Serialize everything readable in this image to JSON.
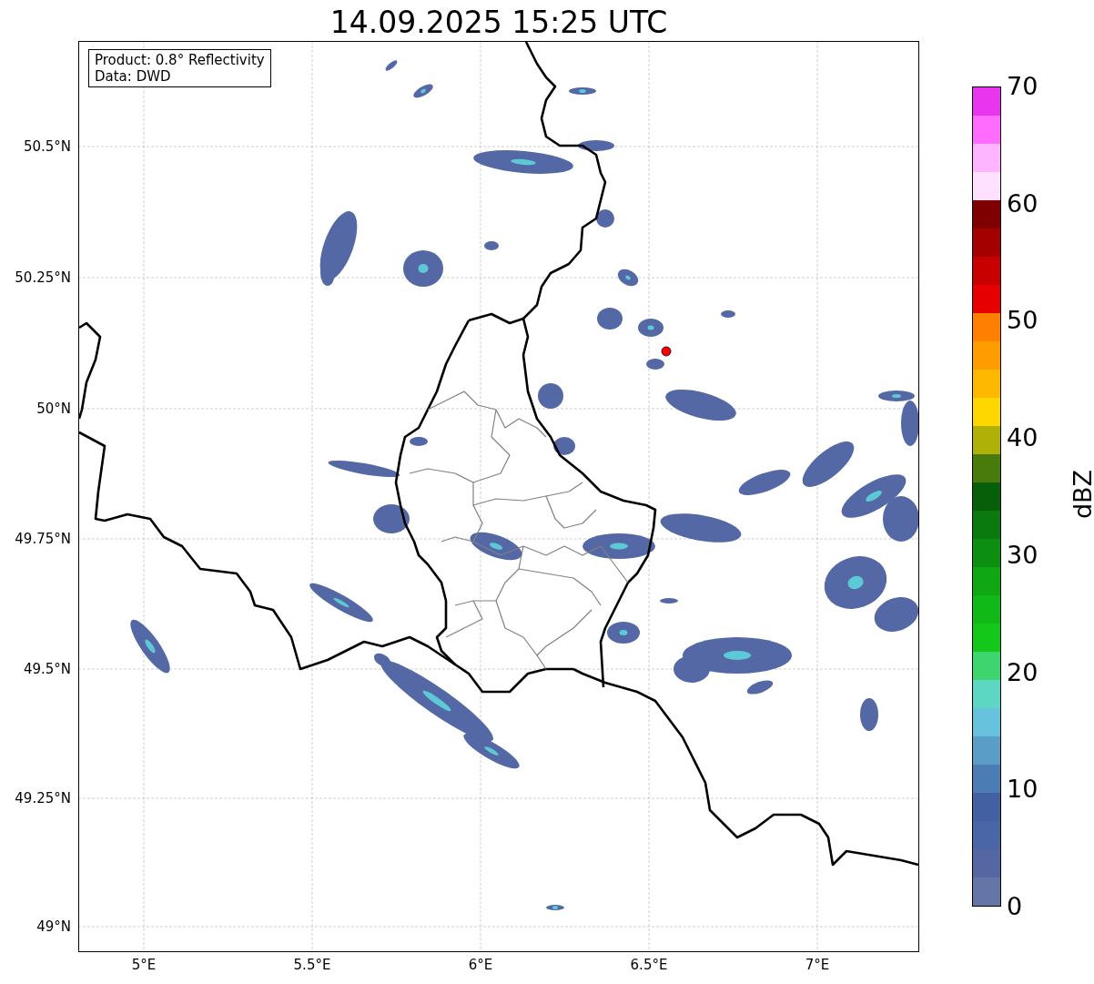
{
  "title": "14.09.2025 15:25 UTC",
  "map": {
    "info_lines": [
      "Product: 0.8° Reflectivity",
      "Data: DWD"
    ],
    "xticks": [
      "5°E",
      "5.5°E",
      "6°E",
      "6.5°E",
      "7°E"
    ],
    "yticks": [
      "50.5°N",
      "50.25°N",
      "50°N",
      "49.75°N",
      "49.5°N",
      "49.25°N",
      "49°N"
    ]
  },
  "colorbar": {
    "label": "dBZ",
    "ticks": [
      "70",
      "60",
      "50",
      "40",
      "30",
      "20",
      "10",
      "0"
    ],
    "bands": [
      {
        "color": "#6475a8"
      },
      {
        "color": "#5567a2"
      },
      {
        "color": "#4a66a6"
      },
      {
        "color": "#4260a2"
      },
      {
        "color": "#4b7db4"
      },
      {
        "color": "#5a9ec7"
      },
      {
        "color": "#66c2dd"
      },
      {
        "color": "#5ed6c4"
      },
      {
        "color": "#3dd56e"
      },
      {
        "color": "#14c81a"
      },
      {
        "color": "#10b818"
      },
      {
        "color": "#0fa812"
      },
      {
        "color": "#0c8e10"
      },
      {
        "color": "#0a7a0e"
      },
      {
        "color": "#085f0a"
      },
      {
        "color": "#487a0c"
      },
      {
        "color": "#afb106"
      },
      {
        "color": "#ffd700"
      },
      {
        "color": "#ffb800"
      },
      {
        "color": "#ff9c00"
      },
      {
        "color": "#ff7f00"
      },
      {
        "color": "#e60000"
      },
      {
        "color": "#c80000"
      },
      {
        "color": "#a50000"
      },
      {
        "color": "#7f0000"
      },
      {
        "color": "#ffe0ff"
      },
      {
        "color": "#ffb4ff"
      },
      {
        "color": "#ff6cff"
      },
      {
        "color": "#e935ed"
      }
    ]
  }
}
